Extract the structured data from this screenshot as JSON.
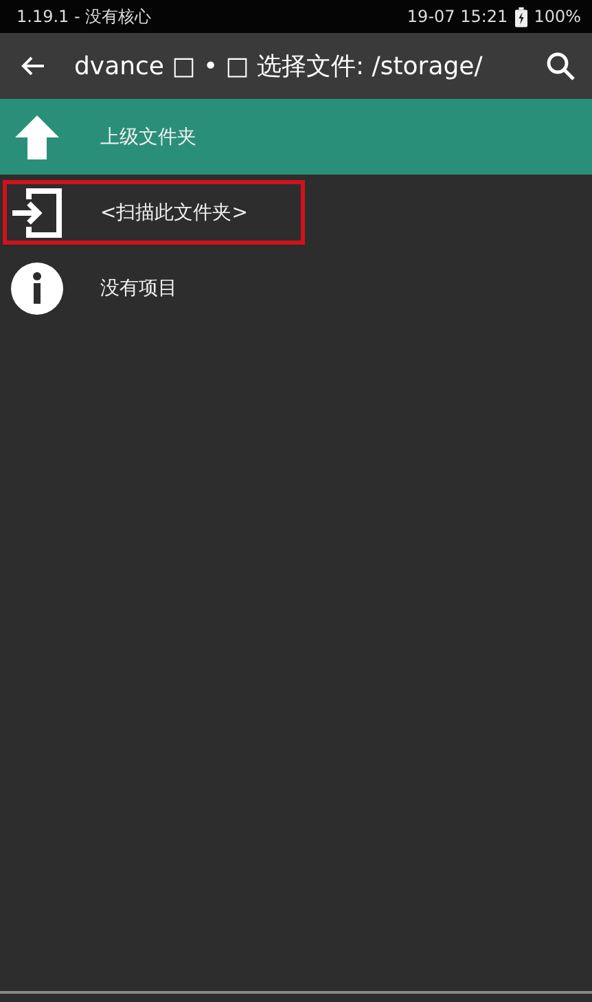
{
  "status_bar": {
    "left": "1.19.1 - 没有核心",
    "time": "19-07 15:21",
    "battery": "100%"
  },
  "toolbar": {
    "title": "dvance □ • □ 选择文件: /storage/"
  },
  "items": [
    {
      "kind": "up",
      "label": "上级文件夹",
      "selected": true,
      "highlighted": false
    },
    {
      "kind": "scan",
      "label": "<扫描此文件夹>",
      "selected": false,
      "highlighted": true
    },
    {
      "kind": "info",
      "label": "没有项目",
      "selected": false,
      "highlighted": false
    }
  ]
}
